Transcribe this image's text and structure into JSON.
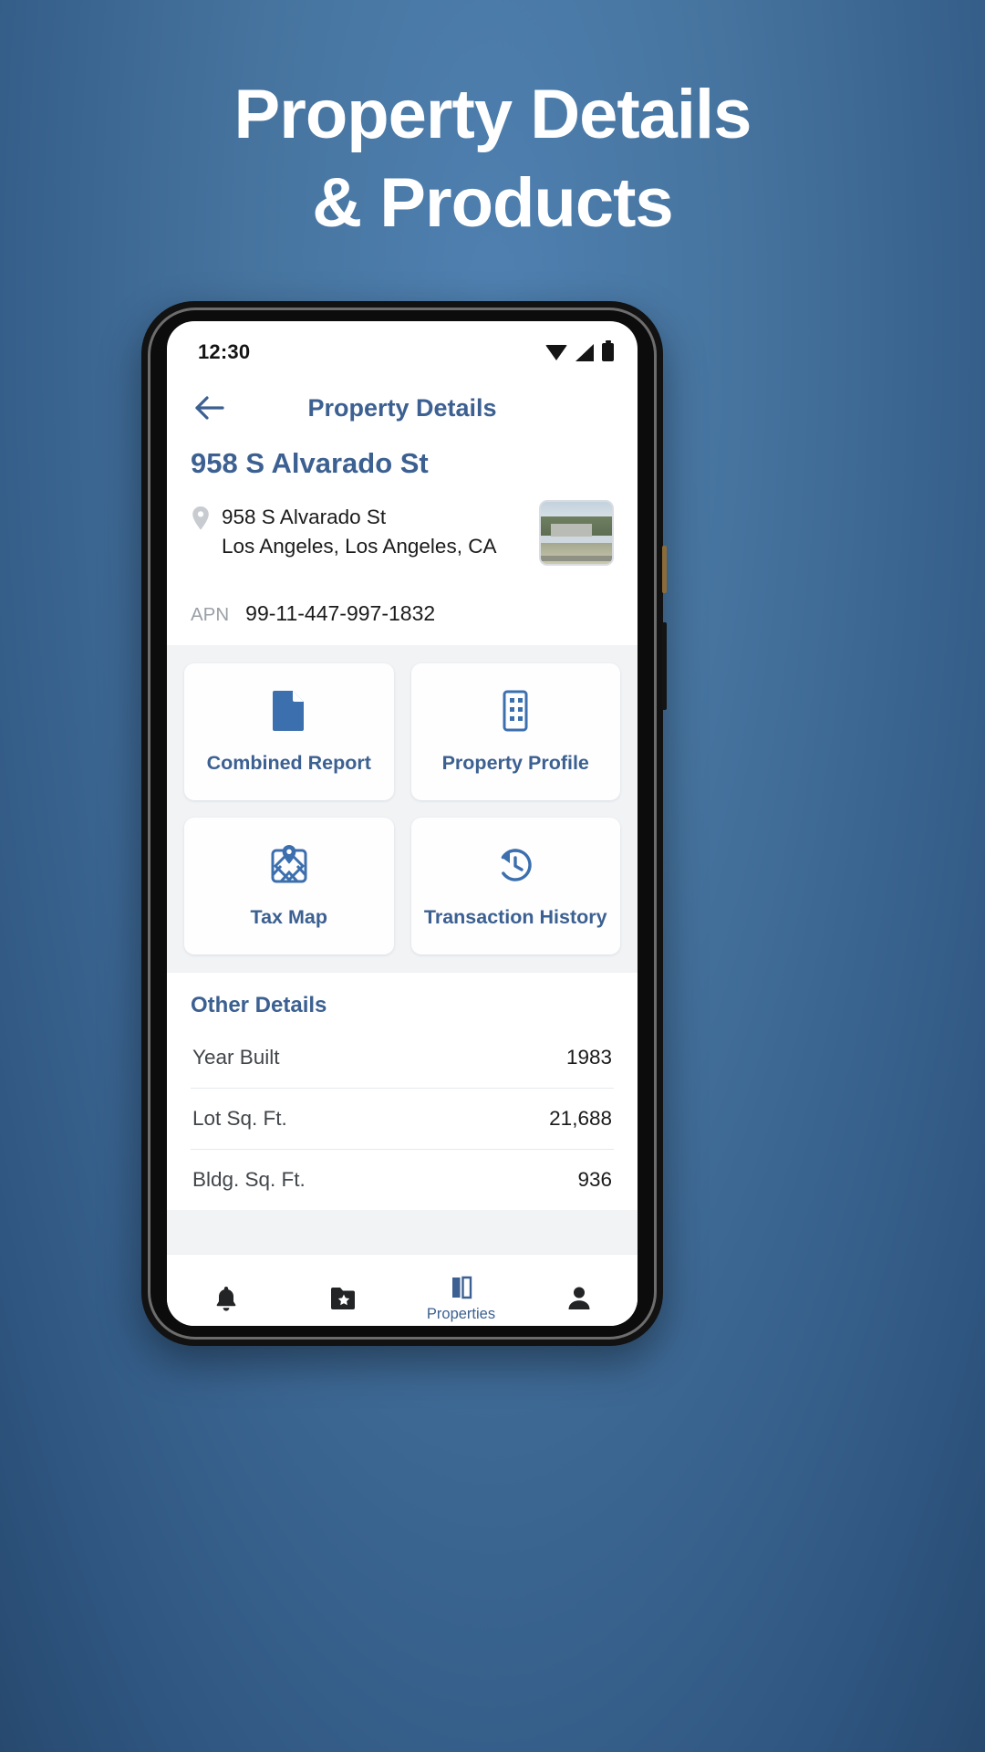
{
  "promo": {
    "headline_line1": "Property Details",
    "headline_line2": "& Products"
  },
  "status_bar": {
    "time": "12:30",
    "icons": [
      "wifi-icon",
      "cell-signal-icon",
      "battery-icon"
    ]
  },
  "app_bar": {
    "back_icon": "arrow-left-icon",
    "title": "Property Details"
  },
  "property": {
    "title": "958 S Alvarado St",
    "pin_icon": "location-pin-icon",
    "address_line1": "958 S Alvarado St",
    "address_line2": "Los Angeles, Los Angeles, CA",
    "thumbnail": "property-photo-thumbnail",
    "apn_label": "APN",
    "apn_value": "99-11-447-997-1832"
  },
  "products": [
    {
      "label": "Combined Report",
      "icon": "document-icon"
    },
    {
      "label": "Property Profile",
      "icon": "building-icon"
    },
    {
      "label": "Tax Map",
      "icon": "map-pin-icon"
    },
    {
      "label": "Transaction History",
      "icon": "history-clock-icon"
    }
  ],
  "other_details": {
    "title": "Other Details",
    "rows": [
      {
        "label": "Year Built",
        "value": "1983"
      },
      {
        "label": "Lot Sq. Ft.",
        "value": "21,688"
      },
      {
        "label": "Bldg. Sq. Ft.",
        "value": "936"
      }
    ]
  },
  "bottom_nav": {
    "items": [
      {
        "label": "",
        "icon": "bell-icon",
        "active": false
      },
      {
        "label": "",
        "icon": "folder-star-icon",
        "active": false
      },
      {
        "label": "Properties",
        "icon": "map-book-icon",
        "active": true
      },
      {
        "label": "",
        "icon": "person-icon",
        "active": false
      }
    ]
  },
  "colors": {
    "brand_blue": "#3c6091",
    "background_blue": "#3a6490",
    "card_bg": "#fefeff",
    "panel_gray": "#f1f3f5",
    "muted_text": "#9aa0a6"
  }
}
